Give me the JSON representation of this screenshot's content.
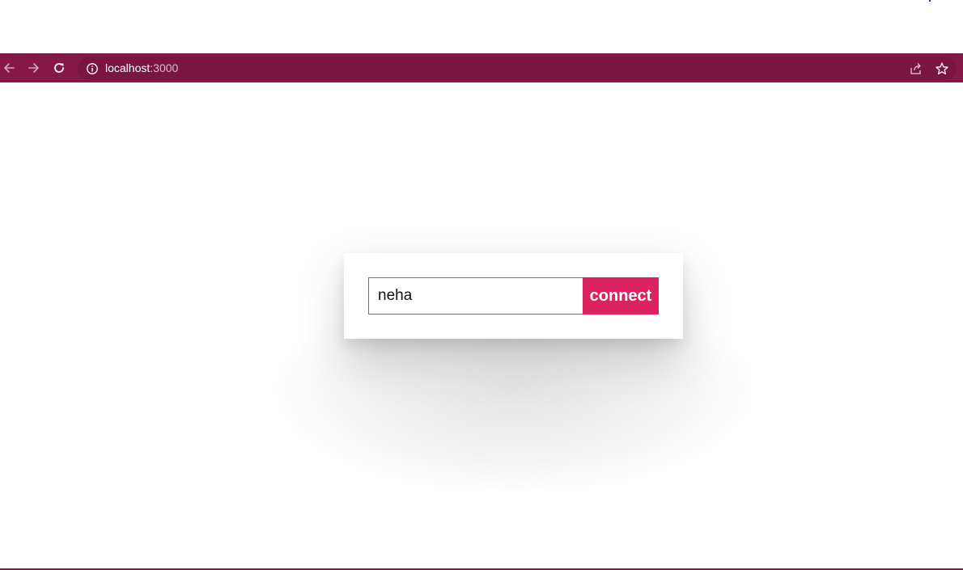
{
  "browser": {
    "url_host": "localhost",
    "url_port": ":3000",
    "toolbar_color": "#861846",
    "icons": {
      "back": "back-arrow-icon",
      "forward": "forward-arrow-icon",
      "reload": "reload-icon",
      "site_info": "info-icon",
      "share": "share-icon",
      "bookmark": "star-icon"
    }
  },
  "form": {
    "name_value": "neha",
    "connect_label": "connect",
    "accent": "#dc2360"
  }
}
